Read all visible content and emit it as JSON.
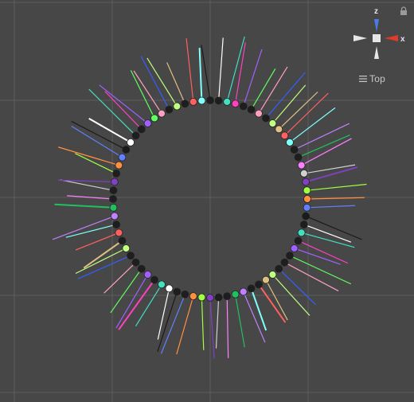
{
  "view": {
    "orientation_label": "Top",
    "background": "#474747",
    "grid_color": "#5c5c5c"
  },
  "gizmo": {
    "axis_z_label": "z",
    "axis_x_label": "x",
    "axis_z_color": "#4a7be8",
    "axis_x_color": "#e03a2e",
    "neutral_color": "#e6e6e6"
  },
  "icons": {
    "lock": "lock-icon",
    "menu": "hamburger-menu-icon"
  },
  "scene": {
    "object_count": 72,
    "colors": [
      "#1a1a1a",
      "#ffffff",
      "#40e0c0",
      "#ff40c0",
      "#a060ff",
      "#60ff60",
      "#ffa0c0",
      "#3060ff",
      "#c0ff80",
      "#e0c080",
      "#ff6060",
      "#80ffff",
      "#c080ff",
      "#20c060",
      "#ff80ff",
      "#d0d0d0",
      "#8040c0",
      "#a0ff40",
      "#ff9040",
      "#6080ff"
    ]
  }
}
